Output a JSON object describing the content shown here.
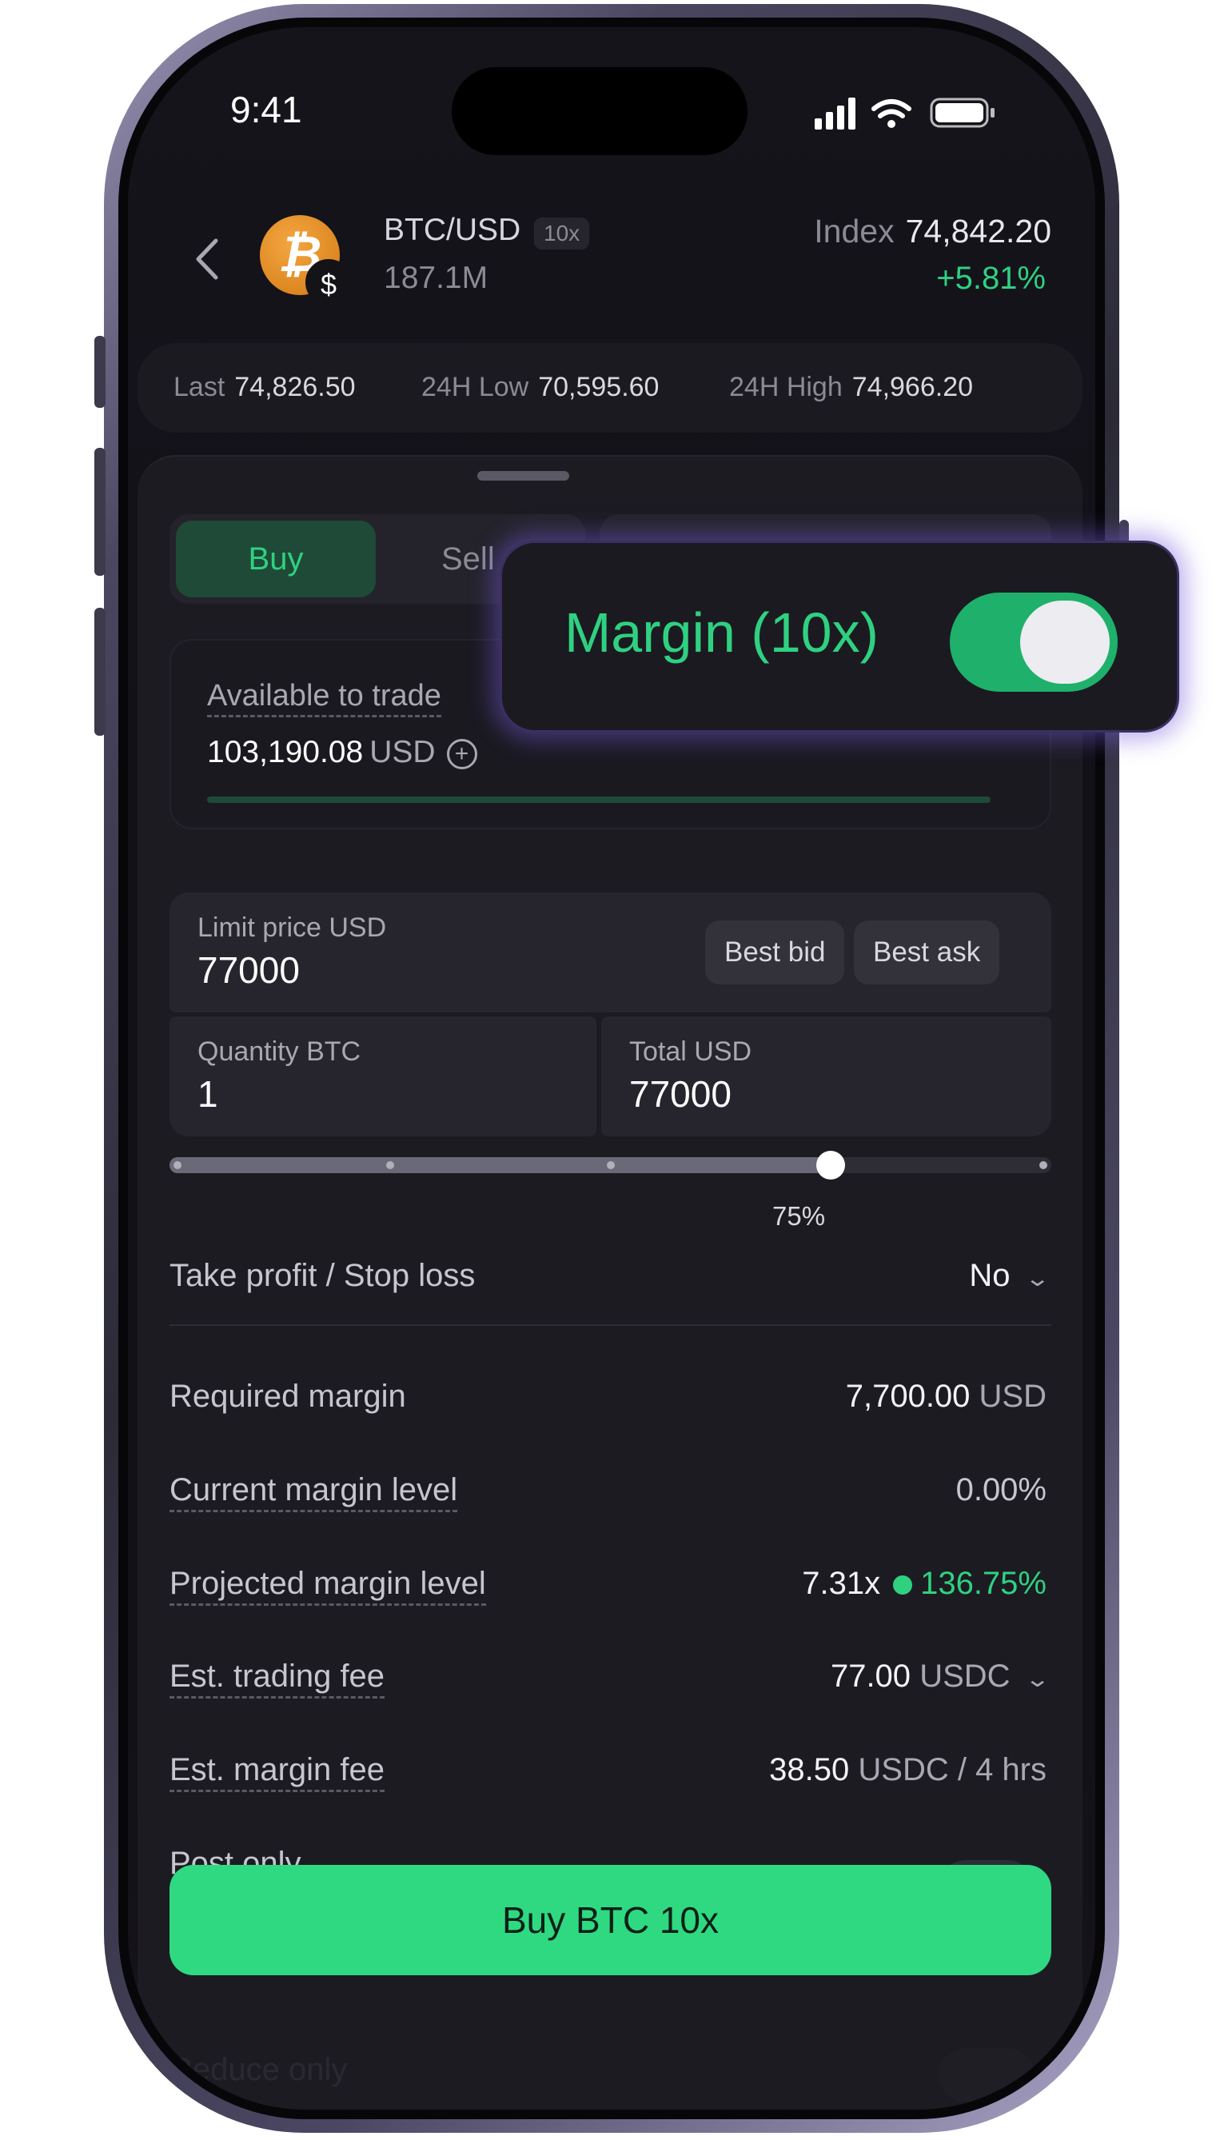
{
  "status": {
    "time": "9:41"
  },
  "header": {
    "pair": "BTC/USD",
    "leverage_badge": "10x",
    "volume": "187.1M",
    "index_label": "Index",
    "index_value": "74,842.20",
    "change": "+5.81%"
  },
  "stats": [
    {
      "label": "Last",
      "value": "74,826.50"
    },
    {
      "label": "24H Low",
      "value": "70,595.60"
    },
    {
      "label": "24H High",
      "value": "74,966.20"
    }
  ],
  "order": {
    "tabs": {
      "buy": "Buy",
      "sell": "Sell"
    },
    "available_label": "Available to trade",
    "available_amount": "103,190.08",
    "available_unit": "USD",
    "limit_label": "Limit price USD",
    "limit_value": "77000",
    "best_bid": "Best bid",
    "best_ask": "Best ask",
    "quantity_label": "Quantity BTC",
    "quantity_value": "1",
    "total_label": "Total USD",
    "total_value": "77000",
    "slider_percent_label": "75%",
    "slider_fraction": 0.75
  },
  "details": {
    "tpsl_label": "Take profit / Stop loss",
    "tpsl_value": "No",
    "required_margin_label": "Required margin",
    "required_margin_value": "7,700.00",
    "required_margin_unit": "USD",
    "current_margin_label": "Current margin level",
    "current_margin_value": "0.00%",
    "projected_margin_label": "Projected margin level",
    "projected_margin_multiplier": "7.31x",
    "projected_margin_percent": "136.75%",
    "trading_fee_label": "Est. trading fee",
    "trading_fee_value": "77.00",
    "trading_fee_unit": "USDC",
    "margin_fee_label": "Est. margin fee",
    "margin_fee_value": "38.50",
    "margin_fee_unit": "USDC / 4 hrs",
    "post_only_label": "Post only",
    "reduce_only_label": "Reduce only"
  },
  "action": {
    "buy_button": "Buy BTC 10x"
  },
  "callout": {
    "label": "Margin (10x)",
    "toggle_on": true
  },
  "colors": {
    "accent_green": "#2fd181",
    "button_green": "#2fd982",
    "background": "#121118"
  }
}
